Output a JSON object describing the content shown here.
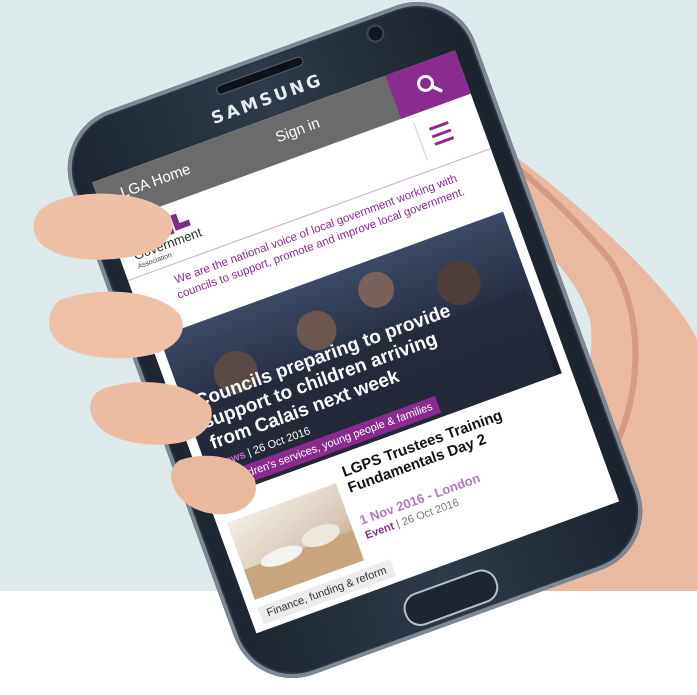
{
  "phone": {
    "brand": "SAMSUNG"
  },
  "site": {
    "nav": {
      "back_label": "LGA Home",
      "signin_label": "Sign in"
    },
    "logo": {
      "line1": "Local",
      "line2": "Government",
      "line3": "Association"
    },
    "tagline": "We are the national voice of local government working with councils to support, promote and improve local government.",
    "news": {
      "title": "Councils preparing to provide support to children arriving from Calais next week",
      "kind": "News",
      "date": "26 Oct 2016",
      "tag": "Children's services, young people & families"
    },
    "event": {
      "title": "LGPS Trustees Training Fundamentals Day 2",
      "date_place": "1 Nov 2016 - London",
      "kind": "Event",
      "posted": "26 Oct 2016",
      "tag": "Finance, funding & reform"
    }
  },
  "colors": {
    "brand_purple": "#8b2a8f",
    "topbar_grey": "#6b6b6b"
  }
}
